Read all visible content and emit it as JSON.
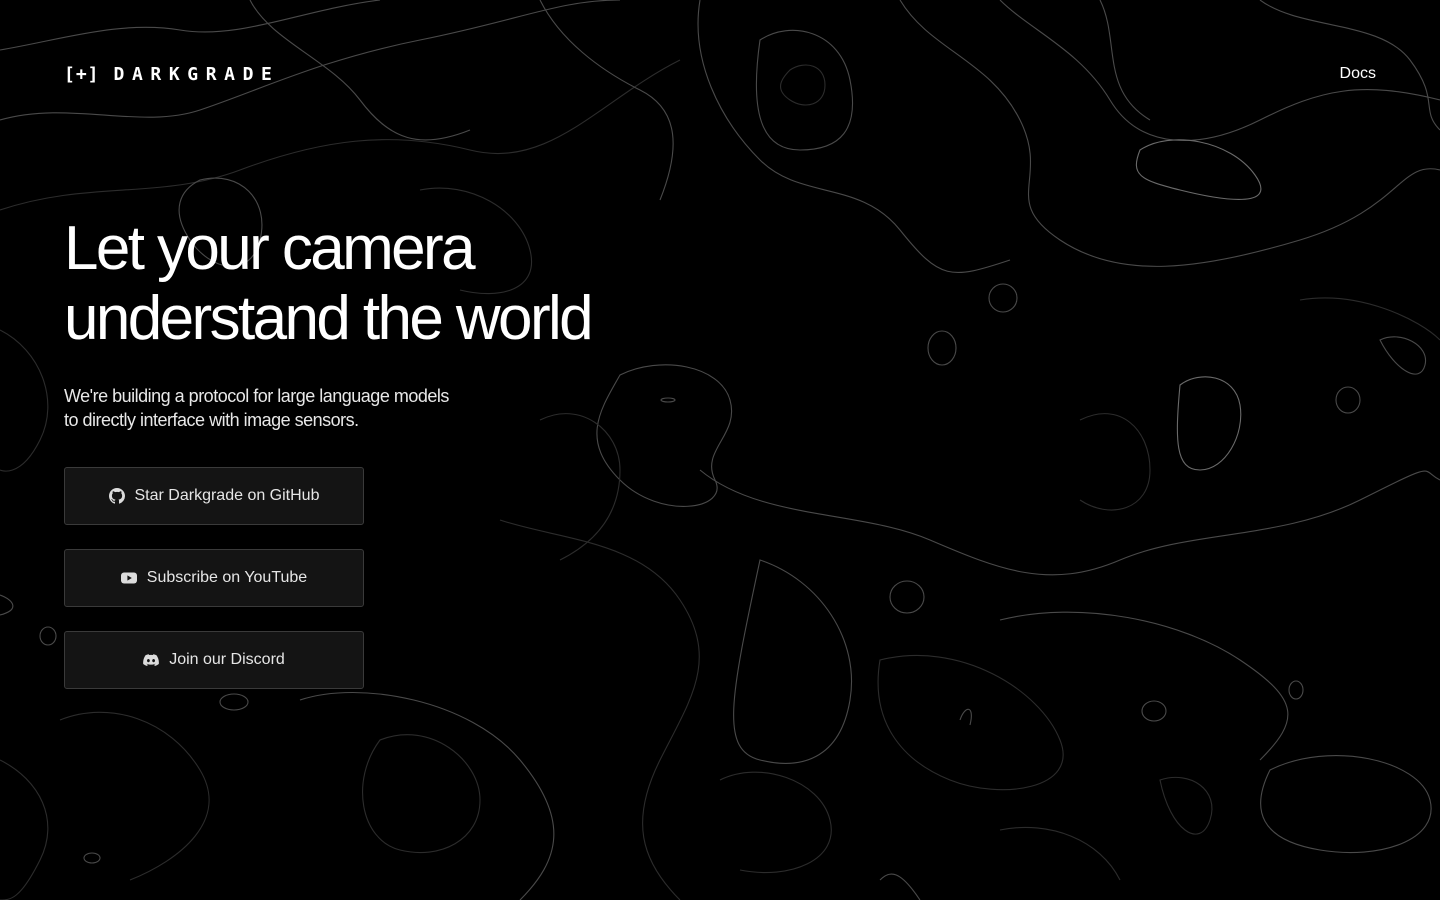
{
  "header": {
    "logo_mark": "[+]",
    "logo_text": "DARKGRADE",
    "nav": {
      "docs_label": "Docs"
    }
  },
  "hero": {
    "title_line_1": "Let your camera",
    "title_line_2": "understand the world",
    "subtitle": "We're building a protocol for large language models to directly interface with image sensors."
  },
  "cta": {
    "github": {
      "label": "Star Darkgrade on GitHub",
      "icon": "github-icon"
    },
    "youtube": {
      "label": "Subscribe on YouTube",
      "icon": "youtube-icon"
    },
    "discord": {
      "label": "Join our Discord",
      "icon": "discord-icon"
    }
  },
  "colors": {
    "background": "#000000",
    "text": "#ffffff",
    "button_bg": "#141414",
    "button_border": "#3a3a3a",
    "contour_line": "#4a4a4a"
  }
}
